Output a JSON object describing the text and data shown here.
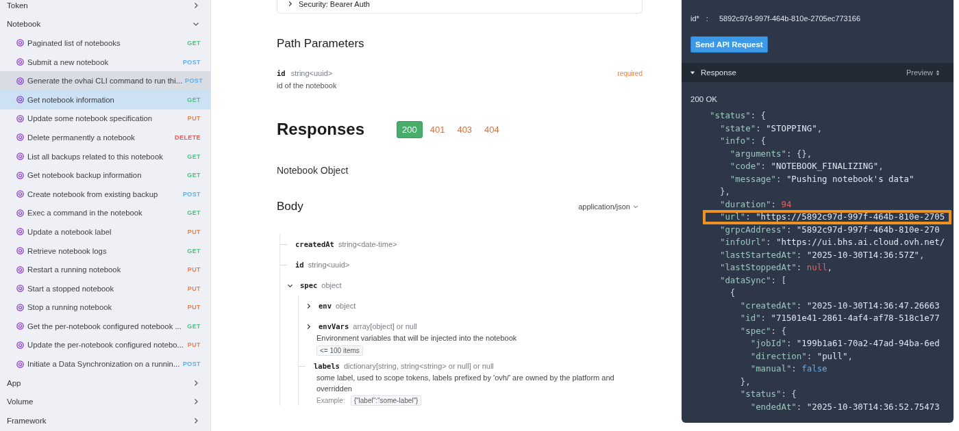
{
  "sidebar": {
    "groups": [
      {
        "label": "Token",
        "expanded": false
      },
      {
        "label": "Notebook",
        "expanded": true,
        "items": [
          {
            "label": "Paginated list of notebooks",
            "method": "GET",
            "color": "#4fbf7f",
            "selected": false,
            "hovered": false
          },
          {
            "label": "Submit a new notebook",
            "method": "POST",
            "color": "#5aaef2",
            "selected": false,
            "hovered": false
          },
          {
            "label": "Generate the ovhai CLI command to run thi...",
            "method": "POST",
            "color": "#5aaef2",
            "selected": false,
            "hovered": true
          },
          {
            "label": "Get notebook information",
            "method": "GET",
            "color": "#4fbf7f",
            "selected": true,
            "hovered": false
          },
          {
            "label": "Update some notebook specification",
            "method": "PUT",
            "color": "#ef7d45",
            "selected": false,
            "hovered": false
          },
          {
            "label": "Delete permanently a notebook",
            "method": "DELETE",
            "color": "#e55a5a",
            "selected": false,
            "hovered": false
          },
          {
            "label": "List all backups related to this notebook",
            "method": "GET",
            "color": "#4fbf7f",
            "selected": false,
            "hovered": false
          },
          {
            "label": "Get notebook backup information",
            "method": "GET",
            "color": "#4fbf7f",
            "selected": false,
            "hovered": false
          },
          {
            "label": "Create notebook from existing backup",
            "method": "POST",
            "color": "#5aaef2",
            "selected": false,
            "hovered": false
          },
          {
            "label": "Exec a command in the notebook",
            "method": "GET",
            "color": "#4fbf7f",
            "selected": false,
            "hovered": false
          },
          {
            "label": "Update a notebook label",
            "method": "PUT",
            "color": "#ef7d45",
            "selected": false,
            "hovered": false
          },
          {
            "label": "Retrieve notebook logs",
            "method": "GET",
            "color": "#4fbf7f",
            "selected": false,
            "hovered": false
          },
          {
            "label": "Restart a running notebook",
            "method": "PUT",
            "color": "#ef7d45",
            "selected": false,
            "hovered": false
          },
          {
            "label": "Start a stopped notebook",
            "method": "PUT",
            "color": "#ef7d45",
            "selected": false,
            "hovered": false
          },
          {
            "label": "Stop a running notebook",
            "method": "PUT",
            "color": "#ef7d45",
            "selected": false,
            "hovered": false
          },
          {
            "label": "Get the per-notebook configured notebook ...",
            "method": "GET",
            "color": "#4fbf7f",
            "selected": false,
            "hovered": false
          },
          {
            "label": "Update the per-notebook configured notebo...",
            "method": "PUT",
            "color": "#ef7d45",
            "selected": false,
            "hovered": false
          },
          {
            "label": "Initiate a Data Synchronization on a runnin...",
            "method": "POST",
            "color": "#5aaef2",
            "selected": false,
            "hovered": false
          }
        ]
      },
      {
        "label": "App",
        "expanded": false
      },
      {
        "label": "Volume",
        "expanded": false
      },
      {
        "label": "Framework",
        "expanded": false
      }
    ]
  },
  "main": {
    "security": {
      "label": "Security: Bearer Auth",
      "expanded": false
    },
    "path_parameters": {
      "title": "Path Parameters",
      "params": [
        {
          "name": "id",
          "type": "string<uuid>",
          "required": "required",
          "description": "id of the notebook"
        }
      ]
    },
    "responses": {
      "title": "Responses",
      "codes": [
        {
          "label": "200",
          "selected": true
        },
        {
          "label": "401",
          "selected": false
        },
        {
          "label": "403",
          "selected": false
        },
        {
          "label": "404",
          "selected": false
        }
      ],
      "object": "Notebook Object"
    },
    "body": {
      "title": "Body",
      "content_type": "application/json",
      "fields": [
        {
          "name": "createdAt",
          "type": "string<date-time>"
        },
        {
          "name": "id",
          "type": "string<uuid>"
        },
        {
          "name": "spec",
          "type": "object",
          "expanded": true,
          "children": [
            {
              "name": "env",
              "type": "object",
              "expanded": false
            },
            {
              "name": "envVars",
              "type": "array[object] or null",
              "expanded": false,
              "description": "Environment variables that will be injected into the notebook",
              "constraint": "<= 100 items"
            },
            {
              "name": "labels",
              "type": "dictionary[string, string<string> or null] or null",
              "description": "some label, used to scope tokens, labels prefixed by 'ovh/' are owned by the platform and overridden",
              "example_label": "Example:",
              "example": "{\"label\":\"some-label\"}"
            }
          ]
        }
      ]
    }
  },
  "console": {
    "param": {
      "label": "id*",
      "separator": ":",
      "value": "5892c97d-997f-464b-810e-2705ec773166"
    },
    "send_button": "Send API Request",
    "response": {
      "title": "Response",
      "expanded": true,
      "view": "Preview",
      "status": "200 OK",
      "lines": [
        {
          "highlighted": false,
          "tokens": [
            {
              "t": "\"status\"",
              "kind": "key"
            },
            {
              "t": ": {",
              "kind": "p"
            }
          ]
        },
        {
          "highlighted": false,
          "tokens": [
            {
              "t": "  \"state\"",
              "kind": "key"
            },
            {
              "t": ": ",
              "kind": "p"
            },
            {
              "t": "\"STOPPING\"",
              "kind": "str"
            },
            {
              "t": ",",
              "kind": "p"
            }
          ]
        },
        {
          "highlighted": false,
          "tokens": [
            {
              "t": "  \"info\"",
              "kind": "key"
            },
            {
              "t": ": {",
              "kind": "p"
            }
          ]
        },
        {
          "highlighted": false,
          "tokens": [
            {
              "t": "    \"arguments\"",
              "kind": "key"
            },
            {
              "t": ": {},",
              "kind": "p"
            }
          ]
        },
        {
          "highlighted": false,
          "tokens": [
            {
              "t": "    \"code\"",
              "kind": "key"
            },
            {
              "t": ": ",
              "kind": "p"
            },
            {
              "t": "\"NOTEBOOK_FINALIZING\"",
              "kind": "str"
            },
            {
              "t": ",",
              "kind": "p"
            }
          ]
        },
        {
          "highlighted": false,
          "tokens": [
            {
              "t": "    \"message\"",
              "kind": "key"
            },
            {
              "t": ": ",
              "kind": "p"
            },
            {
              "t": "\"Pushing notebook's data\"",
              "kind": "str"
            }
          ]
        },
        {
          "highlighted": false,
          "tokens": [
            {
              "t": "  },",
              "kind": "p"
            }
          ]
        },
        {
          "highlighted": false,
          "tokens": [
            {
              "t": "  \"duration\"",
              "kind": "key"
            },
            {
              "t": ": ",
              "kind": "p"
            },
            {
              "t": "94",
              "kind": "num"
            }
          ]
        },
        {
          "highlighted": true,
          "tokens": [
            {
              "t": "  \"url\"",
              "kind": "key"
            },
            {
              "t": ": ",
              "kind": "p"
            },
            {
              "t": "\"https://5892c97d-997f-464b-810e-2705",
              "kind": "str"
            }
          ]
        },
        {
          "highlighted": false,
          "tokens": [
            {
              "t": "  \"grpcAddress\"",
              "kind": "key"
            },
            {
              "t": ": ",
              "kind": "p"
            },
            {
              "t": "\"5892c97d-997f-464b-810e-270",
              "kind": "str"
            }
          ]
        },
        {
          "highlighted": false,
          "tokens": [
            {
              "t": "  \"infoUrl\"",
              "kind": "key"
            },
            {
              "t": ": ",
              "kind": "p"
            },
            {
              "t": "\"https://ui.bhs.ai.cloud.ovh.net/",
              "kind": "str"
            }
          ]
        },
        {
          "highlighted": false,
          "tokens": [
            {
              "t": "  \"lastStartedAt\"",
              "kind": "key"
            },
            {
              "t": ": ",
              "kind": "p"
            },
            {
              "t": "\"2025-10-30T14:36:57Z\"",
              "kind": "str"
            },
            {
              "t": ",",
              "kind": "p"
            }
          ]
        },
        {
          "highlighted": false,
          "tokens": [
            {
              "t": "  \"lastStoppedAt\"",
              "kind": "key"
            },
            {
              "t": ": ",
              "kind": "p"
            },
            {
              "t": "null",
              "kind": "null"
            },
            {
              "t": ",",
              "kind": "p"
            }
          ]
        },
        {
          "highlighted": false,
          "tokens": [
            {
              "t": "  \"dataSync\"",
              "kind": "key"
            },
            {
              "t": ": [",
              "kind": "p"
            }
          ]
        },
        {
          "highlighted": false,
          "tokens": [
            {
              "t": "    {",
              "kind": "p"
            }
          ]
        },
        {
          "highlighted": false,
          "tokens": [
            {
              "t": "      \"createdAt\"",
              "kind": "key"
            },
            {
              "t": ": ",
              "kind": "p"
            },
            {
              "t": "\"2025-10-30T14:36:47.26663",
              "kind": "str"
            }
          ]
        },
        {
          "highlighted": false,
          "tokens": [
            {
              "t": "      \"id\"",
              "kind": "key"
            },
            {
              "t": ": ",
              "kind": "p"
            },
            {
              "t": "\"71501e41-2861-4af4-af78-518c1e77",
              "kind": "str"
            }
          ]
        },
        {
          "highlighted": false,
          "tokens": [
            {
              "t": "      \"spec\"",
              "kind": "key"
            },
            {
              "t": ": {",
              "kind": "p"
            }
          ]
        },
        {
          "highlighted": false,
          "tokens": [
            {
              "t": "        \"jobId\"",
              "kind": "key"
            },
            {
              "t": ": ",
              "kind": "p"
            },
            {
              "t": "\"199b1a61-70a2-47ad-94ba-6ed",
              "kind": "str"
            }
          ]
        },
        {
          "highlighted": false,
          "tokens": [
            {
              "t": "        \"direction\"",
              "kind": "key"
            },
            {
              "t": ": ",
              "kind": "p"
            },
            {
              "t": "\"pull\"",
              "kind": "str"
            },
            {
              "t": ",",
              "kind": "p"
            }
          ]
        },
        {
          "highlighted": false,
          "tokens": [
            {
              "t": "        \"manual\"",
              "kind": "key"
            },
            {
              "t": ": ",
              "kind": "p"
            },
            {
              "t": "false",
              "kind": "bool"
            }
          ]
        },
        {
          "highlighted": false,
          "tokens": [
            {
              "t": "      },",
              "kind": "p"
            }
          ]
        },
        {
          "highlighted": false,
          "tokens": [
            {
              "t": "      \"status\"",
              "kind": "key"
            },
            {
              "t": ": {",
              "kind": "p"
            }
          ]
        },
        {
          "highlighted": false,
          "tokens": [
            {
              "t": "        \"endedAt\"",
              "kind": "key"
            },
            {
              "t": ": ",
              "kind": "p"
            },
            {
              "t": "\"2025-10-30T14:36:52.75473",
              "kind": "str"
            }
          ]
        }
      ]
    }
  }
}
